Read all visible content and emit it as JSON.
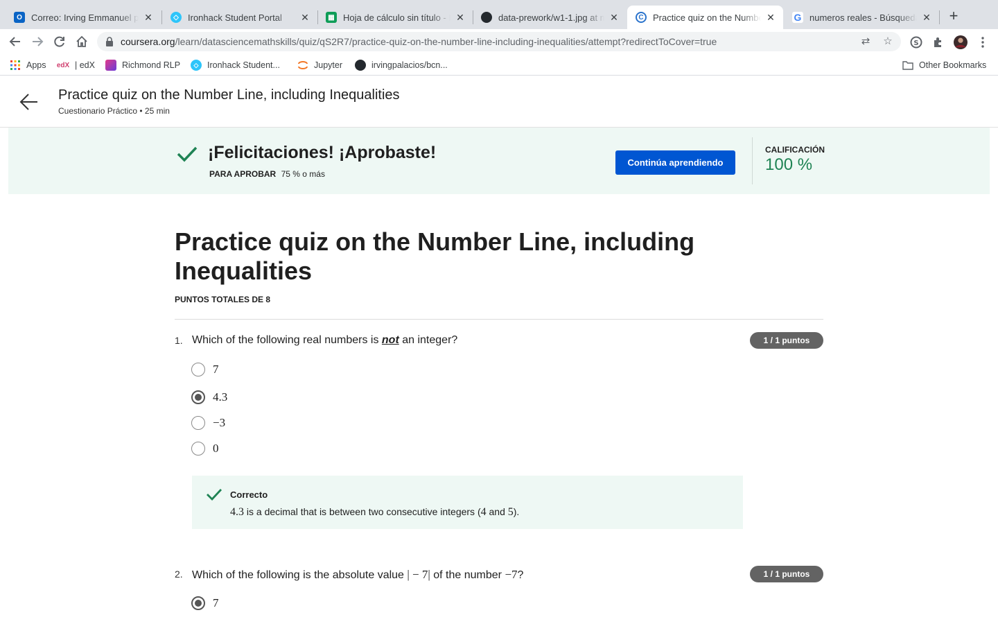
{
  "browser": {
    "tabs": [
      {
        "title": "Correo: Irving Emmanuel pal",
        "icon": "outlook-icon"
      },
      {
        "title": "Ironhack Student Portal",
        "icon": "ironhack-icon"
      },
      {
        "title": "Hoja de cálculo sin título - H",
        "icon": "sheets-icon"
      },
      {
        "title": "data-prework/w1-1.jpg at ma",
        "icon": "github-icon"
      },
      {
        "title": "Practice quiz on the Number",
        "icon": "coursera-icon",
        "active": true
      },
      {
        "title": "numeros reales - Búsqueda",
        "icon": "google-icon"
      }
    ],
    "url_host": "coursera.org",
    "url_path": "/learn/datasciencemathskills/quiz/qS2R7/practice-quiz-on-the-number-line-including-inequalities/attempt?redirectToCover=true",
    "bookmarks": [
      {
        "label": "Apps",
        "icon": "apps-grid-icon"
      },
      {
        "label": "| edX",
        "icon": "edx-icon"
      },
      {
        "label": "Richmond RLP",
        "icon": "richmond-icon"
      },
      {
        "label": "Ironhack Student...",
        "icon": "ironhack-icon"
      },
      {
        "label": "Jupyter",
        "icon": "jupyter-icon"
      },
      {
        "label": "irvingpalacios/bcn...",
        "icon": "github-icon"
      }
    ],
    "other_bookmarks": "Other Bookmarks"
  },
  "header": {
    "title": "Practice quiz on the Number Line, including Inequalities",
    "subtitle": "Cuestionario Práctico • 25 min"
  },
  "banner": {
    "heading": "¡Felicitaciones! ¡Aprobaste!",
    "pass_label": "PARA APROBAR",
    "pass_value": "75 % o más",
    "button": "Continúa aprendiendo",
    "grade_label": "CALIFICACIÓN",
    "grade_value": "100 %",
    "accent": "#1f8354",
    "button_color": "#0056d2"
  },
  "quiz": {
    "title": "Practice quiz on the Number Line, including Inequalities",
    "total_points": "PUNTOS TOTALES DE 8",
    "questions": [
      {
        "number": "1.",
        "text_before": "Which of the following real numbers is ",
        "text_emphasis": "not",
        "text_after": " an integer?",
        "points": "1 / 1 puntos",
        "options": [
          "7",
          "4.3",
          "−3",
          "0"
        ],
        "selected_index": 1,
        "feedback_title": "Correcto",
        "feedback_math": "4.3",
        "feedback_text_1": " is a decimal that is between two consecutive integers (",
        "feedback_math_2": "4",
        "feedback_text_2": " and ",
        "feedback_math_3": "5",
        "feedback_text_3": ")."
      },
      {
        "number": "2.",
        "text_before": "Which of the following is the absolute value ",
        "text_math_1": "| − 7|",
        "text_middle": " of the number ",
        "text_math_2": "−7",
        "text_after": "?",
        "points": "1 / 1 puntos",
        "options": [
          "7"
        ],
        "selected_index": 0
      }
    ]
  }
}
